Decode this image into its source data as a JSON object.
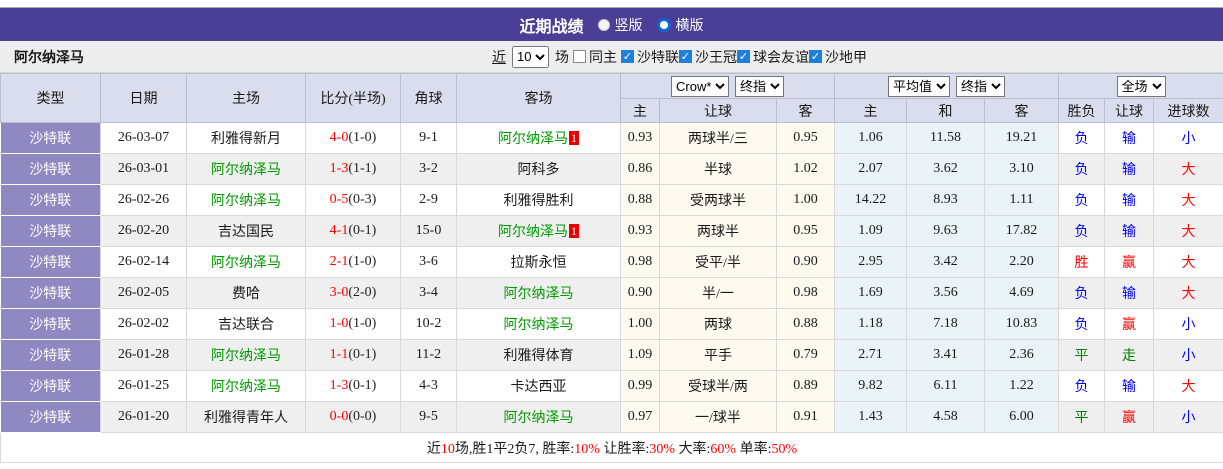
{
  "titlebar": {
    "title": "近期战绩",
    "vertical_label": "竖版",
    "horizontal_label": "横版",
    "selected_layout": "横版"
  },
  "filter": {
    "team": "阿尔纳泽马",
    "near_label": "近",
    "count": "10",
    "games_label": "场",
    "same_home_label": "同主",
    "same_home_checked": false,
    "leagues": [
      "沙特联",
      "沙王冠",
      "球会友谊",
      "沙地甲"
    ]
  },
  "header": {
    "col_type": "类型",
    "col_date": "日期",
    "col_home": "主场",
    "col_score": "比分(半场)",
    "col_corner": "角球",
    "col_away": "客场",
    "odds_company_select": "Crow*",
    "odds_time_select": "终指",
    "avg_select": "平均值",
    "avg_time_select": "终指",
    "scope_select": "全场",
    "sub": [
      "主",
      "让球",
      "客",
      "主",
      "和",
      "客",
      "胜负",
      "让球",
      "进球数"
    ]
  },
  "rows": [
    {
      "league": "沙特联",
      "date": "26-03-07",
      "home": "利雅得新月",
      "home_is_self": false,
      "home_badge": "",
      "score": "4-0",
      "half": "(1-0)",
      "corner": "9-1",
      "away": "阿尔纳泽马",
      "away_is_self": true,
      "away_badge": "1",
      "crow_home": "0.93",
      "crow_handicap": "两球半/三",
      "crow_away": "0.95",
      "avg_home": "1.06",
      "avg_draw": "11.58",
      "avg_away": "19.21",
      "outcome": "负",
      "outcome_tone": "loss",
      "handicap_result": "输",
      "handicap_tone": "loss",
      "goals": "小",
      "goals_tone": "small"
    },
    {
      "league": "沙特联",
      "date": "26-03-01",
      "home": "阿尔纳泽马",
      "home_is_self": true,
      "home_badge": "",
      "score": "1-3",
      "half": "(1-1)",
      "corner": "3-2",
      "away": "阿科多",
      "away_is_self": false,
      "away_badge": "",
      "crow_home": "0.86",
      "crow_handicap": "半球",
      "crow_away": "1.02",
      "avg_home": "2.07",
      "avg_draw": "3.62",
      "avg_away": "3.10",
      "outcome": "负",
      "outcome_tone": "loss",
      "handicap_result": "输",
      "handicap_tone": "loss",
      "goals": "大",
      "goals_tone": "big"
    },
    {
      "league": "沙特联",
      "date": "26-02-26",
      "home": "阿尔纳泽马",
      "home_is_self": true,
      "home_badge": "",
      "score": "0-5",
      "half": "(0-3)",
      "corner": "2-9",
      "away": "利雅得胜利",
      "away_is_self": false,
      "away_badge": "",
      "crow_home": "0.88",
      "crow_handicap": "受两球半",
      "crow_away": "1.00",
      "avg_home": "14.22",
      "avg_draw": "8.93",
      "avg_away": "1.11",
      "outcome": "负",
      "outcome_tone": "loss",
      "handicap_result": "输",
      "handicap_tone": "loss",
      "goals": "大",
      "goals_tone": "big"
    },
    {
      "league": "沙特联",
      "date": "26-02-20",
      "home": "吉达国民",
      "home_is_self": false,
      "home_badge": "",
      "score": "4-1",
      "half": "(0-1)",
      "corner": "15-0",
      "away": "阿尔纳泽马",
      "away_is_self": true,
      "away_badge": "1",
      "crow_home": "0.93",
      "crow_handicap": "两球半",
      "crow_away": "0.95",
      "avg_home": "1.09",
      "avg_draw": "9.63",
      "avg_away": "17.82",
      "outcome": "负",
      "outcome_tone": "loss",
      "handicap_result": "输",
      "handicap_tone": "loss",
      "goals": "大",
      "goals_tone": "big"
    },
    {
      "league": "沙特联",
      "date": "26-02-14",
      "home": "阿尔纳泽马",
      "home_is_self": true,
      "home_badge": "",
      "score": "2-1",
      "half": "(1-0)",
      "corner": "3-6",
      "away": "拉斯永恒",
      "away_is_self": false,
      "away_badge": "",
      "crow_home": "0.98",
      "crow_handicap": "受平/半",
      "crow_away": "0.90",
      "avg_home": "2.95",
      "avg_draw": "3.42",
      "avg_away": "2.20",
      "outcome": "胜",
      "outcome_tone": "win",
      "handicap_result": "赢",
      "handicap_tone": "win",
      "goals": "大",
      "goals_tone": "big"
    },
    {
      "league": "沙特联",
      "date": "26-02-05",
      "home": "费哈",
      "home_is_self": false,
      "home_badge": "",
      "score": "3-0",
      "half": "(2-0)",
      "corner": "3-4",
      "away": "阿尔纳泽马",
      "away_is_self": true,
      "away_badge": "",
      "crow_home": "0.90",
      "crow_handicap": "半/一",
      "crow_away": "0.98",
      "avg_home": "1.69",
      "avg_draw": "3.56",
      "avg_away": "4.69",
      "outcome": "负",
      "outcome_tone": "loss",
      "handicap_result": "输",
      "handicap_tone": "loss",
      "goals": "大",
      "goals_tone": "big"
    },
    {
      "league": "沙特联",
      "date": "26-02-02",
      "home": "吉达联合",
      "home_is_self": false,
      "home_badge": "",
      "score": "1-0",
      "half": "(1-0)",
      "corner": "10-2",
      "away": "阿尔纳泽马",
      "away_is_self": true,
      "away_badge": "",
      "crow_home": "1.00",
      "crow_handicap": "两球",
      "crow_away": "0.88",
      "avg_home": "1.18",
      "avg_draw": "7.18",
      "avg_away": "10.83",
      "outcome": "负",
      "outcome_tone": "loss",
      "handicap_result": "赢",
      "handicap_tone": "win",
      "goals": "小",
      "goals_tone": "small"
    },
    {
      "league": "沙特联",
      "date": "26-01-28",
      "home": "阿尔纳泽马",
      "home_is_self": true,
      "home_badge": "",
      "score": "1-1",
      "half": "(0-1)",
      "corner": "11-2",
      "away": "利雅得体育",
      "away_is_self": false,
      "away_badge": "",
      "crow_home": "1.09",
      "crow_handicap": "平手",
      "crow_away": "0.79",
      "avg_home": "2.71",
      "avg_draw": "3.41",
      "avg_away": "2.36",
      "outcome": "平",
      "outcome_tone": "draw",
      "handicap_result": "走",
      "handicap_tone": "draw",
      "goals": "小",
      "goals_tone": "small"
    },
    {
      "league": "沙特联",
      "date": "26-01-25",
      "home": "阿尔纳泽马",
      "home_is_self": true,
      "home_badge": "",
      "score": "1-3",
      "half": "(0-1)",
      "corner": "4-3",
      "away": "卡达西亚",
      "away_is_self": false,
      "away_badge": "",
      "crow_home": "0.99",
      "crow_handicap": "受球半/两",
      "crow_away": "0.89",
      "avg_home": "9.82",
      "avg_draw": "6.11",
      "avg_away": "1.22",
      "outcome": "负",
      "outcome_tone": "loss",
      "handicap_result": "输",
      "handicap_tone": "loss",
      "goals": "大",
      "goals_tone": "big"
    },
    {
      "league": "沙特联",
      "date": "26-01-20",
      "home": "利雅得青年人",
      "home_is_self": false,
      "home_badge": "",
      "score": "0-0",
      "half": "(0-0)",
      "corner": "9-5",
      "away": "阿尔纳泽马",
      "away_is_self": true,
      "away_badge": "",
      "crow_home": "0.97",
      "crow_handicap": "一/球半",
      "crow_away": "0.91",
      "avg_home": "1.43",
      "avg_draw": "4.58",
      "avg_away": "6.00",
      "outcome": "平",
      "outcome_tone": "draw",
      "handicap_result": "赢",
      "handicap_tone": "win",
      "goals": "小",
      "goals_tone": "small"
    }
  ],
  "summary": {
    "segments": [
      {
        "text": "近",
        "red": false
      },
      {
        "text": "10",
        "red": true
      },
      {
        "text": "场,胜1平2负7, 胜率:",
        "red": false
      },
      {
        "text": "10%",
        "red": true
      },
      {
        "text": " 让胜率:",
        "red": false
      },
      {
        "text": "30%",
        "red": true
      },
      {
        "text": " 大率:",
        "red": false
      },
      {
        "text": "60%",
        "red": true
      },
      {
        "text": " 单率:",
        "red": false
      },
      {
        "text": "50%",
        "red": true
      }
    ]
  },
  "colors": {
    "titlebar_purple": "#4a3e96",
    "type_cell_purple": "#8f88c1",
    "header_blue": "#d9ddee",
    "stripe_gray": "#efefef",
    "odds_cream": "#fffaf0",
    "avg_blue": "#e9f3f8",
    "self_team_green": "#009900",
    "score_red": "#ff0000",
    "loss_blue": "#0000ff",
    "win_red": "#ff0000",
    "draw_green": "#008000",
    "checkbox_blue": "#1e80d8"
  }
}
